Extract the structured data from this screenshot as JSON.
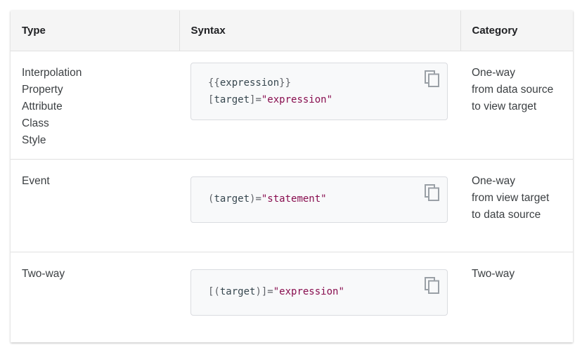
{
  "headers": {
    "type": "Type",
    "syntax": "Syntax",
    "category": "Category"
  },
  "rows": [
    {
      "type_lines": [
        "Interpolation",
        "Property",
        "Attribute",
        "Class",
        "Style"
      ],
      "code": [
        [
          {
            "t": "p",
            "v": "{{"
          },
          {
            "t": "x",
            "v": "expression"
          },
          {
            "t": "p",
            "v": "}}"
          }
        ],
        [
          {
            "t": "p",
            "v": "["
          },
          {
            "t": "x",
            "v": "target"
          },
          {
            "t": "p",
            "v": "]="
          },
          {
            "t": "s",
            "v": "\"expression\""
          }
        ]
      ],
      "category_lines": [
        "One-way",
        "from data source",
        "to view target"
      ]
    },
    {
      "type_lines": [
        "Event"
      ],
      "code": [
        [
          {
            "t": "p",
            "v": "("
          },
          {
            "t": "x",
            "v": "target"
          },
          {
            "t": "p",
            "v": ")="
          },
          {
            "t": "s",
            "v": "\"statement\""
          }
        ]
      ],
      "category_lines": [
        "One-way",
        "from view target",
        "to data source"
      ]
    },
    {
      "type_lines": [
        "Two-way"
      ],
      "code": [
        [
          {
            "t": "p",
            "v": "[("
          },
          {
            "t": "x",
            "v": "target"
          },
          {
            "t": "p",
            "v": ")]="
          },
          {
            "t": "s",
            "v": "\"expression\""
          }
        ]
      ],
      "category_lines": [
        "Two-way"
      ]
    }
  ],
  "icons": {
    "copy": "copy-icon"
  }
}
